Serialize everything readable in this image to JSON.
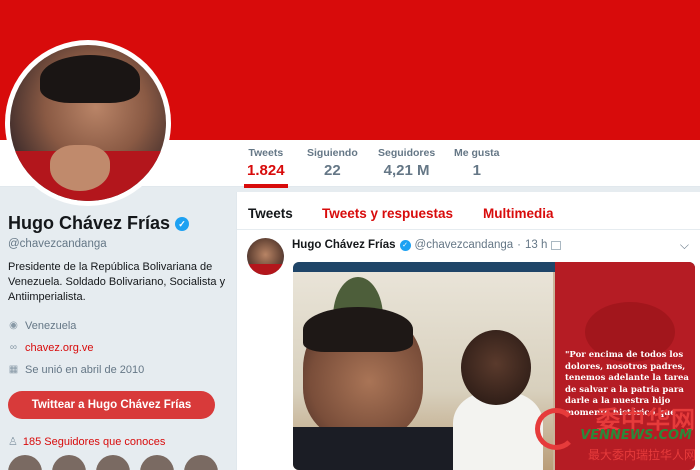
{
  "colors": {
    "accent": "#d80b0b",
    "verified": "#1da1f2",
    "button": "#d83a3a"
  },
  "stats": [
    {
      "label": "Tweets",
      "value": "1.824",
      "active": true
    },
    {
      "label": "Siguiendo",
      "value": "22",
      "active": false
    },
    {
      "label": "Seguidores",
      "value": "4,21 M",
      "active": false
    },
    {
      "label": "Me gusta",
      "value": "1",
      "active": false
    }
  ],
  "profile": {
    "name": "Hugo Chávez Frías",
    "handle": "@chavezcandanga",
    "bio": "Presidente de la República Bolivariana de Venezuela. Soldado Bolivariano, Socialista y Antiimperialista.",
    "location": "Venezuela",
    "website": "chavez.org.ve",
    "joined": "Se unió en abril de 2010",
    "tweet_button": "Twittear a Hugo Chávez Frías",
    "followers_you_know": "185 Seguidores que conoces",
    "icons": {
      "location": "map-pin-icon",
      "link": "link-icon",
      "calendar": "calendar-icon",
      "people": "people-icon",
      "verified": "verified-badge-icon"
    }
  },
  "tabs": [
    "Tweets",
    "Tweets y respuestas",
    "Multimedia"
  ],
  "tweet": {
    "name": "Hugo Chávez Frías",
    "handle": "@chavezcandanga",
    "separator": "·",
    "time": "13 h",
    "media_quote": "\"Por encima de todos los dolores, nosotros padres, tenemos adelante la tarea de salvar a la patria para darle a la nuestra hijo momento histórico que"
  },
  "watermark": {
    "main": "委中华网",
    "url": "VENNEWS.COM",
    "sub": "最大委内瑞拉华人网"
  }
}
